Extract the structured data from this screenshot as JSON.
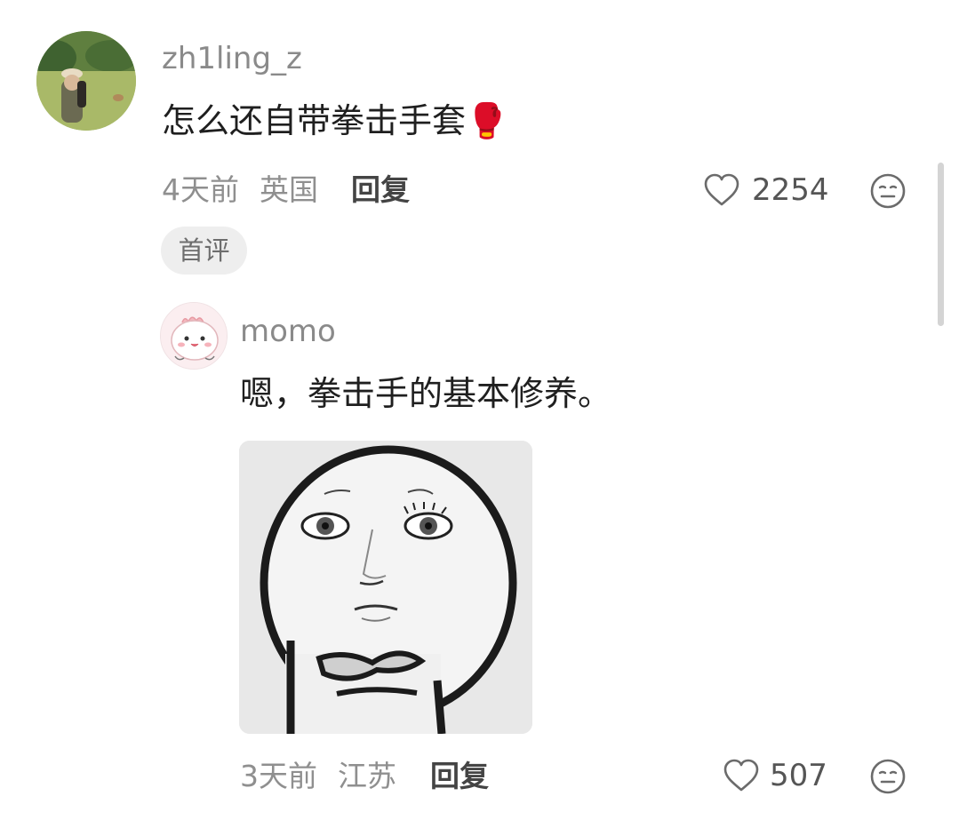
{
  "comment": {
    "username": "zh1ling_z",
    "text": "怎么还自带拳击手套🥊",
    "time_ago": "4天前",
    "location": "英国",
    "reply_label": "回复",
    "like_count": "2254",
    "badge": "首评"
  },
  "reply": {
    "username": "momo",
    "text": "嗯，拳击手的基本修养。",
    "time_ago": "3天前",
    "location": "江苏",
    "reply_label": "回复",
    "like_count": "507"
  },
  "icons": {
    "like": "heart-outline-icon",
    "dislike": "unamused-face-icon"
  },
  "colors": {
    "username": "#8a8a8a",
    "meta": "#8f8f8f",
    "badge_bg": "#eeeeee"
  }
}
